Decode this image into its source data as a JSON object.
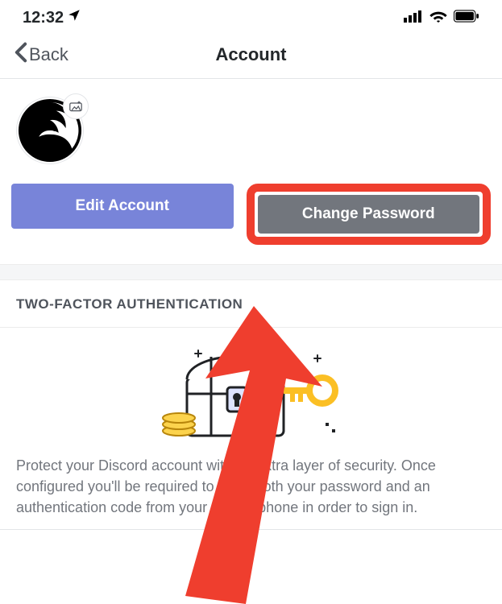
{
  "status": {
    "time": "12:32"
  },
  "nav": {
    "back_label": "Back",
    "title": "Account"
  },
  "buttons": {
    "edit_account": "Edit Account",
    "change_password": "Change Password"
  },
  "section": {
    "twofa_header": "TWO-FACTOR AUTHENTICATION",
    "twofa_desc": "Protect your Discord account with an extra layer of security. Once configured you'll be required to enter both your password and an authentication code from your mobile phone in order to sign in."
  }
}
